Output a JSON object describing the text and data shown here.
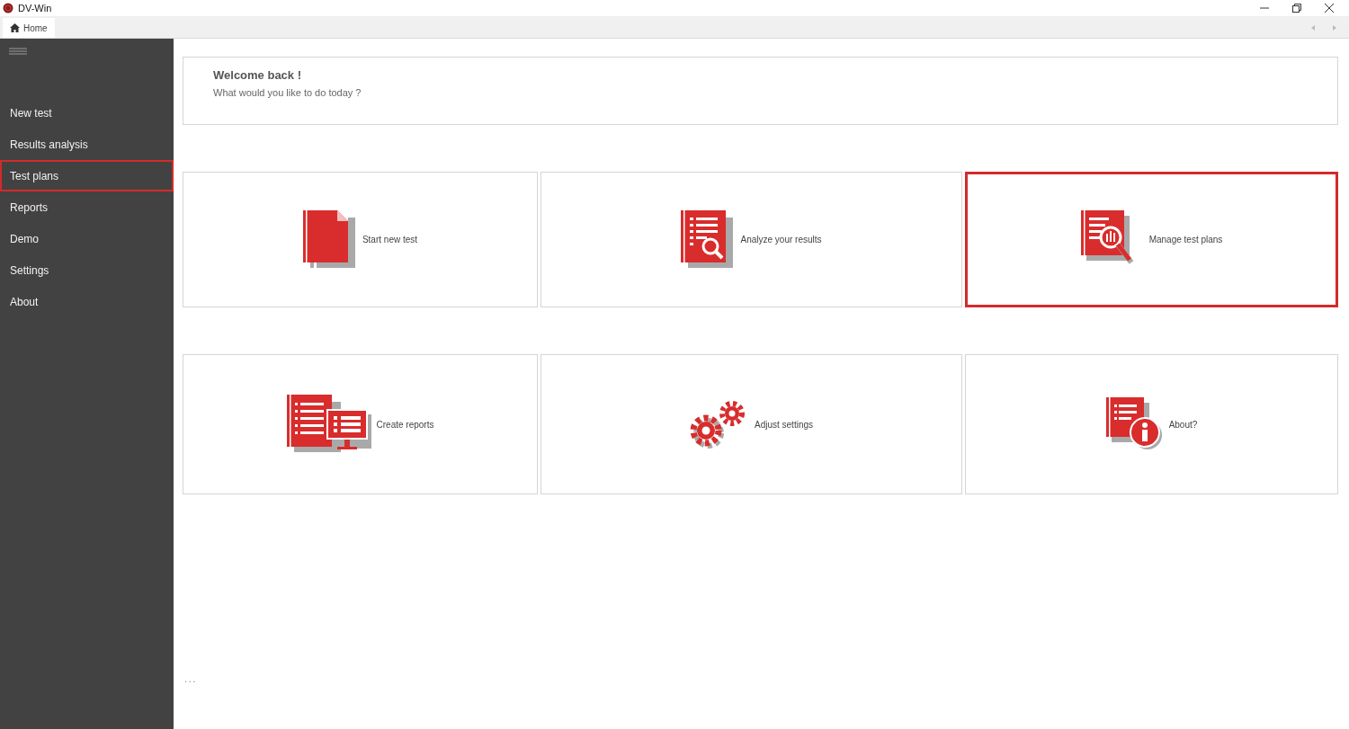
{
  "window": {
    "title": "DV-Win"
  },
  "tabs": [
    {
      "label": "Home",
      "selected": true
    }
  ],
  "sidebar": {
    "items": [
      {
        "label": "New test",
        "selected": false
      },
      {
        "label": "Results analysis",
        "selected": false
      },
      {
        "label": "Test plans",
        "selected": true
      },
      {
        "label": "Reports",
        "selected": false
      },
      {
        "label": "Demo",
        "selected": false
      },
      {
        "label": "Settings",
        "selected": false
      },
      {
        "label": "About",
        "selected": false
      }
    ]
  },
  "welcome": {
    "title": "Welcome back !",
    "subtitle": "What would you like to do today ?"
  },
  "cards": [
    {
      "kind": "new",
      "label": "Start new test",
      "selected": false
    },
    {
      "kind": "analyze",
      "label": "Analyze your results",
      "selected": false
    },
    {
      "kind": "plans",
      "label": "Manage test plans",
      "selected": true
    },
    {
      "kind": "reports",
      "label": "Create reports",
      "selected": false
    },
    {
      "kind": "settings",
      "label": "Adjust settings",
      "selected": false
    },
    {
      "kind": "about",
      "label": "About?",
      "selected": false
    }
  ],
  "footer": "..."
}
